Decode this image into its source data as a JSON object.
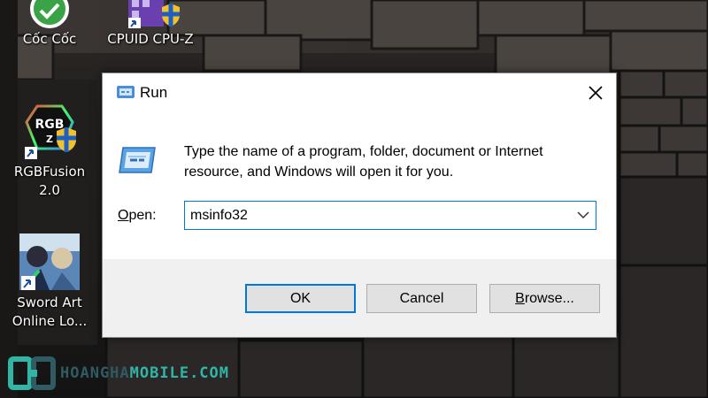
{
  "desktop": {
    "icons": [
      {
        "label_lines": [
          "Cốc Cốc"
        ],
        "icon": "coccoc-browser-icon",
        "shortcut": true
      },
      {
        "label_lines": [
          "CPUID CPU-Z"
        ],
        "icon": "cpuz-icon",
        "shortcut": true
      },
      {
        "label_lines": [
          "RGBFusion",
          "2.0"
        ],
        "icon": "rgbfusion-icon",
        "shortcut": true,
        "admin_shield": true
      },
      {
        "label_lines": [
          "Sword Art",
          "Online Lo..."
        ],
        "icon": "sword-art-online-game-icon",
        "shortcut": true
      }
    ],
    "rgb_icon_text": "RGB",
    "rgb_icon_sub": "Z"
  },
  "run_dialog": {
    "title": "Run",
    "title_icon": "run-icon",
    "instructions": "Type the name of a program, folder, document or Internet resource, and Windows will open it for you.",
    "open_label_prefix": "",
    "open_label_accel": "O",
    "open_label_rest": "pen:",
    "open_value": "msinfo32",
    "buttons": {
      "ok": "OK",
      "cancel": "Cancel",
      "browse_accel": "B",
      "browse_rest": "rowse..."
    },
    "accent_color": "#0078d7"
  },
  "watermark": {
    "part1": "HOANGHA",
    "part2": "MOBILE.COM",
    "colors": {
      "dark": "#2f5b63",
      "light": "#2fb6a6"
    }
  }
}
